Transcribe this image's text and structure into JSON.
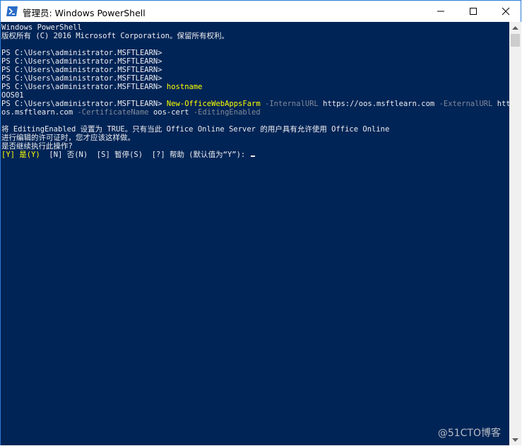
{
  "window": {
    "title": "管理员: Windows PowerShell",
    "icon": "powershell-icon",
    "controls": {
      "minimize": "minimize-icon",
      "maximize": "maximize-icon",
      "close": "close-icon"
    }
  },
  "console": {
    "lines": [
      {
        "text": "Windows PowerShell"
      },
      {
        "text": "版权所有 (C) 2016 Microsoft Corporation。保留所有权利。"
      },
      {
        "text": ""
      },
      {
        "text": "PS C:\\Users\\administrator.MSFTLEARN>"
      },
      {
        "text": "PS C:\\Users\\administrator.MSFTLEARN>"
      },
      {
        "text": "PS C:\\Users\\administrator.MSFTLEARN>"
      },
      {
        "text": "PS C:\\Users\\administrator.MSFTLEARN>"
      },
      {
        "prompt": "PS C:\\Users\\administrator.MSFTLEARN> ",
        "command": "hostname"
      },
      {
        "text": "OOS01"
      },
      {
        "prompt": "PS C:\\Users\\administrator.MSFTLEARN> ",
        "command": "New-OfficeWebAppsFarm",
        "param1": " -InternalURL",
        "value1": " https://oos.msftlearn.com",
        "param2": " -ExternalURL",
        "value2": " https://o"
      },
      {
        "value2_cont": "os.msftlearn.com",
        "param3": " -CertificateName",
        "value3": " oos-cert",
        "param4": " -EditingEnabled"
      },
      {
        "text": ""
      },
      {
        "text": "将 EditingEnabled 设置为 TRUE。只有当此 Office Online Server 的用户具有允许使用 Office Online"
      },
      {
        "text": "进行编辑的许可证时，您才应该这样做。"
      },
      {
        "text": "是否继续执行此操作?"
      },
      {
        "choice_yes": "[Y] 是(Y)",
        "choices_rest": "  [N] 否(N)  [S] 暂停(S)  [?] 帮助 (默认值为“Y”): "
      }
    ],
    "colors": {
      "background": "#012456",
      "text": "#eeedf0",
      "command": "#ffff00",
      "parameter": "#7f8a9a"
    }
  },
  "watermark": "@51CTO博客"
}
